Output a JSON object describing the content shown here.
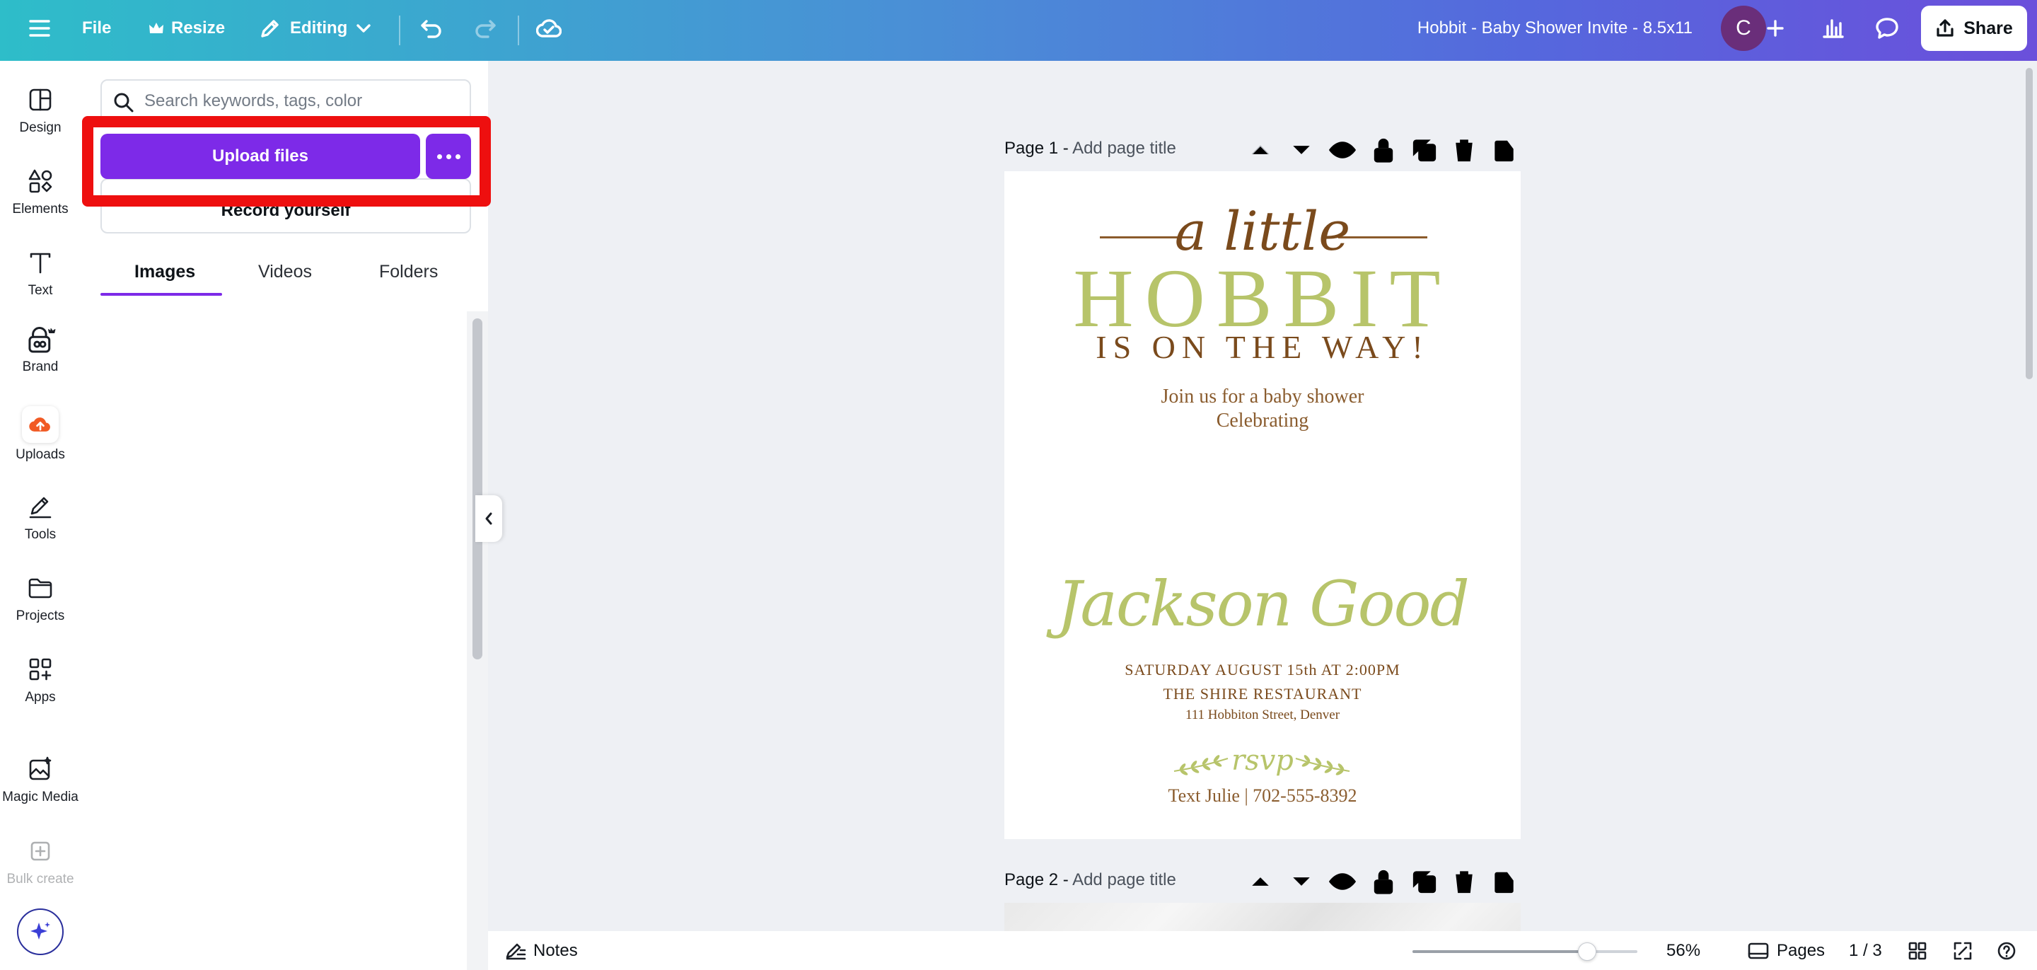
{
  "topbar": {
    "file": "File",
    "resize": "Resize",
    "editing": "Editing",
    "doc_title": "Hobbit - Baby Shower Invite - 8.5x11",
    "avatar_initial": "C",
    "share": "Share"
  },
  "rail": {
    "items": [
      {
        "label": "Design",
        "icon": "layout-icon"
      },
      {
        "label": "Elements",
        "icon": "shapes-icon"
      },
      {
        "label": "Text",
        "icon": "text-icon"
      },
      {
        "label": "Brand",
        "icon": "brand-icon"
      },
      {
        "label": "Uploads",
        "icon": "cloud-upload-icon"
      },
      {
        "label": "Tools",
        "icon": "pen-icon"
      },
      {
        "label": "Projects",
        "icon": "folder-icon"
      },
      {
        "label": "Apps",
        "icon": "apps-icon"
      },
      {
        "label": "Magic Media",
        "icon": "magic-media-icon"
      },
      {
        "label": "Bulk create",
        "icon": "bulk-create-icon"
      }
    ]
  },
  "panel": {
    "search_placeholder": "Search keywords, tags, color",
    "upload_button": "Upload files",
    "record_button": "Record yourself",
    "tabs": [
      "Images",
      "Videos",
      "Folders"
    ]
  },
  "canvas": {
    "page1_label": "Page 1 -",
    "page1_title_placeholder": "Add page title",
    "page2_label": "Page 2 -",
    "page2_title_placeholder": "Add page title"
  },
  "invite": {
    "a_little": "a little",
    "hobbit": "HOBBIT",
    "on_the_way": "IS ON THE WAY!",
    "join": "Join us for a baby shower",
    "celebrating": "Celebrating",
    "name": "Jackson Good",
    "date": "SATURDAY AUGUST 15th AT 2:00PM",
    "venue": "THE SHIRE RESTAURANT",
    "address": "111 Hobbiton Street, Denver",
    "rsvp": "rsvp",
    "contact": "Text Julie | 702-555-8392"
  },
  "bottombar": {
    "notes": "Notes",
    "zoom": "56%",
    "zoom_level": 0.56,
    "pages": "Pages",
    "page_count": "1 / 3"
  },
  "colors": {
    "accent": "#7d2ae8",
    "highlight": "#ee0f0f",
    "hobbit_green": "#b7c46a",
    "brown": "#7a4a1c"
  }
}
